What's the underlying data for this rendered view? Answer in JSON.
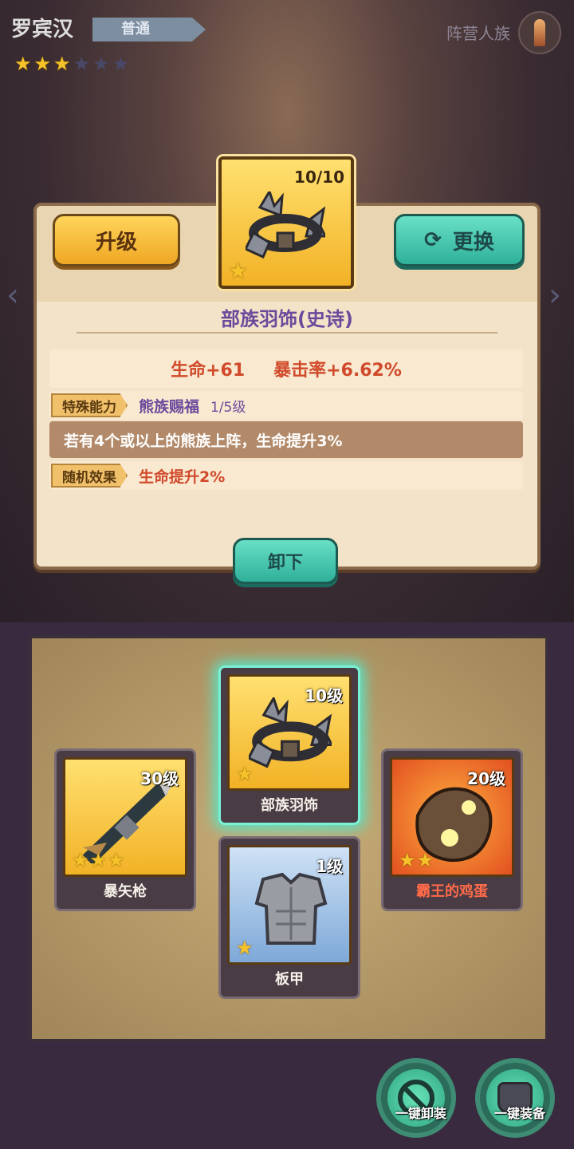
{
  "hero": {
    "name": "罗宾汉",
    "rarity": "普通",
    "stars_filled": 3,
    "stars_total": 6,
    "faction": "阵营人族"
  },
  "panel": {
    "upgrade_label": "升级",
    "swap_label": "更换",
    "item_count": "10/10",
    "item_title": "部族羽饰(史诗)",
    "stat_life": "生命+61",
    "stat_crit": "暴击率+6.62%",
    "special_tag": "特殊能力",
    "special_value": "熊族赐福",
    "special_level": "1/5级",
    "special_desc": "若有4个或以上的熊族上阵，生命提升3%",
    "random_tag": "随机效果",
    "random_value": "生命提升2%",
    "unequip_label": "卸下"
  },
  "slots": {
    "center": {
      "level": "10级",
      "label": "部族羽饰",
      "stars": 1
    },
    "left": {
      "level": "30级",
      "label": "暴矢枪",
      "stars": 3
    },
    "right": {
      "level": "20级",
      "label": "霸王的鸡蛋",
      "stars": 2
    },
    "bottom": {
      "level": "1级",
      "label": "板甲",
      "stars": 1
    }
  },
  "actions": {
    "unequip_all": "一键卸装",
    "equip_all": "一键装备"
  },
  "icons": {
    "star": "star-icon",
    "sync": "sync-icon",
    "no": "prohibit-icon",
    "armor": "armor-icon"
  }
}
